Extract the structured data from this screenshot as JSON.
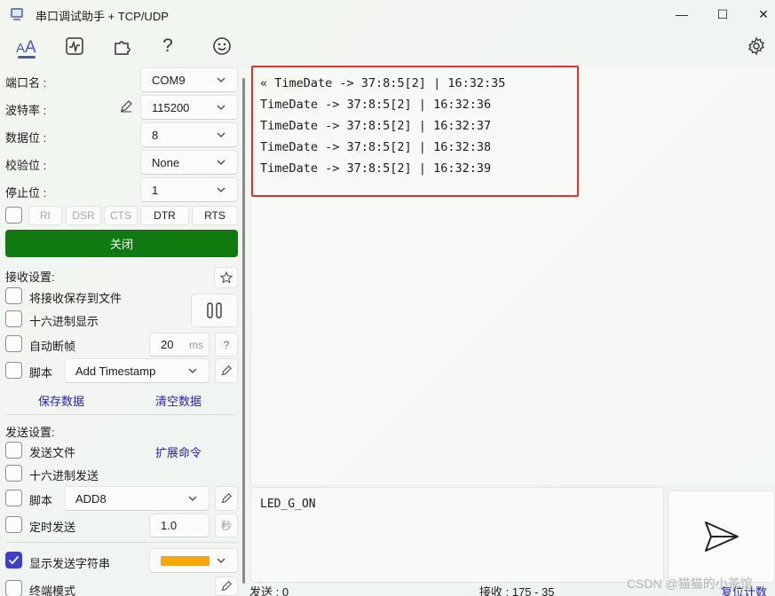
{
  "window": {
    "title": "串口调试助手 + TCP/UDP",
    "minimize_glyph": "—",
    "maximize_glyph": "☐",
    "close_glyph": "✕"
  },
  "toolbar": {
    "items": [
      "font-icon",
      "waveform-icon",
      "plugin-icon",
      "help-icon",
      "smile-icon"
    ],
    "help_label": "?",
    "settings": "gear-icon",
    "accent": "#4a55c5"
  },
  "serial": {
    "port_label": "端口名 :",
    "port_value": "COM9",
    "baud_label": "波特率 :",
    "baud_value": "115200",
    "databits_label": "数据位 :",
    "databits_value": "8",
    "parity_label": "校验位 :",
    "parity_value": "None",
    "stopbits_label": "停止位 :",
    "stopbits_value": "1",
    "signals": [
      "RI",
      "DSR",
      "CTS",
      "DTR",
      "RTS"
    ],
    "close_button": "关闭",
    "close_button_color": "#0f7a0f"
  },
  "receive": {
    "section_label": "接收设置:",
    "save_to_file": "将接收保存到文件",
    "hex_display": "十六进制显示",
    "auto_frame": "自动断帧",
    "frame_value": "20",
    "frame_unit": "ms",
    "help": "?",
    "script_label": "脚本",
    "script_value": "Add Timestamp",
    "save_data": "保存数据",
    "clear_data": "清空数据"
  },
  "send": {
    "section_label": "发送设置:",
    "send_file": "发送文件",
    "extend_cmd": "扩展命令",
    "hex_send": "十六进制发送",
    "script_label": "脚本",
    "script_value": "ADD8",
    "timed_send": "定时发送",
    "timer_value": "1.0",
    "timer_unit": "秒",
    "show_sent": "显示发送字符串",
    "show_sent_checked": true,
    "show_sent_color": "#f8a800",
    "terminal_mode": "终端模式",
    "input_text": "LED_G_ON"
  },
  "output": {
    "lines": [
      "« TimeDate -> 37:8:5[2] | 16:32:35",
      "TimeDate -> 37:8:5[2] | 16:32:36",
      "TimeDate -> 37:8:5[2] | 16:32:37",
      "TimeDate -> 37:8:5[2] | 16:32:38",
      "TimeDate -> 37:8:5[2] | 16:32:39"
    ],
    "highlight_color": "#e5312b"
  },
  "status": {
    "sent": "发送 : 0",
    "received": "接收 : 175 - 35",
    "reset": "复位计数"
  },
  "watermark": "CSDN @猫猫的小茶馆"
}
